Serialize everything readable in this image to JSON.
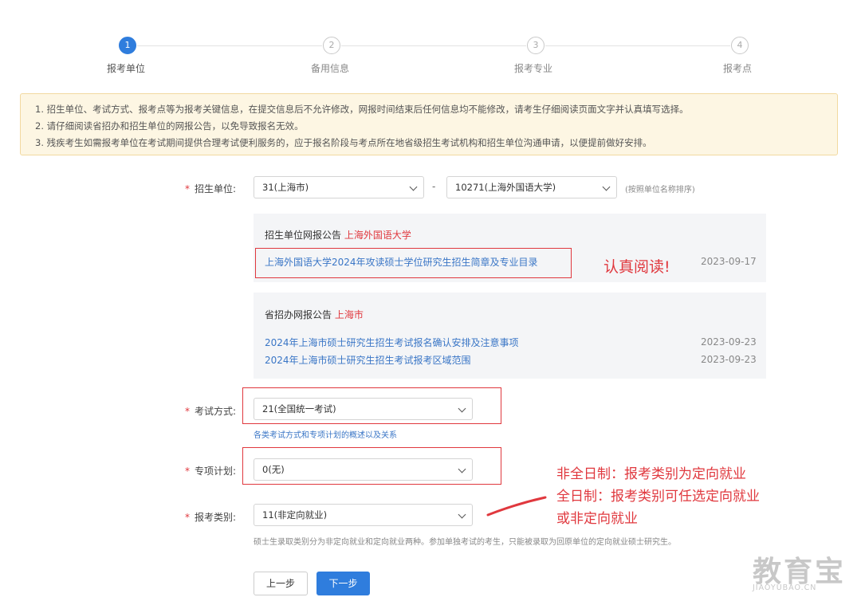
{
  "stepper": {
    "steps": [
      {
        "num": "1",
        "label": "报考单位"
      },
      {
        "num": "2",
        "label": "备用信息"
      },
      {
        "num": "3",
        "label": "报考专业"
      },
      {
        "num": "4",
        "label": "报考点"
      }
    ],
    "active_index": 0
  },
  "notice": {
    "lines": [
      "1. 招生单位、考试方式、报考点等为报考关键信息，在提交信息后不允许修改，网报时间结束后任何信息均不能修改，请考生仔细阅读页面文字并认真填写选择。",
      "2. 请仔细阅读省招办和招生单位的网报公告，以免导致报名无效。",
      "3. 残疾考生如需报考单位在考试期间提供合理考试便利服务的，应于报名阶段与考点所在地省级招生考试机构和招生单位沟通申请，以便提前做好安排。"
    ]
  },
  "form": {
    "unit": {
      "required": "*",
      "label": "招生单位:",
      "province_value": "31(上海市)",
      "separator": "-",
      "school_value": "10271(上海外国语大学)",
      "hint": "(按照单位名称排序)"
    },
    "exam_mode": {
      "required": "*",
      "label": "考试方式:",
      "value": "21(全国统一考试)",
      "hint_link": "各类考试方式和专项计划的概述以及关系"
    },
    "special_plan": {
      "required": "*",
      "label": "专项计划:",
      "value": "0(无)"
    },
    "category": {
      "required": "*",
      "label": "报考类别:",
      "value": "11(非定向就业)",
      "hint": "硕士生录取类别分为非定向就业和定向就业两种。参加单独考试的考生，只能被录取为回原单位的定向就业硕士研究生。"
    }
  },
  "unit_announcement": {
    "title": "招生单位网报公告",
    "title_highlight": "上海外国语大学",
    "items": [
      {
        "text": "上海外国语大学2024年攻读硕士学位研究生招生简章及专业目录",
        "date": "2023-09-17"
      }
    ]
  },
  "province_announcement": {
    "title": "省招办网报公告",
    "title_highlight": "上海市",
    "items": [
      {
        "text": "2024年上海市硕士研究生招生考试报名确认安排及注意事项",
        "date": "2023-09-23"
      },
      {
        "text": "2024年上海市硕士研究生招生考试报考区域范围",
        "date": "2023-09-23"
      }
    ]
  },
  "annotations": {
    "read_note": "认真阅读!",
    "category_note_lines": [
      "非全日制：报考类别为定向就业",
      "全日制：报考类别可任选定向就业",
      "或非定向就业"
    ]
  },
  "buttons": {
    "prev": "上一步",
    "next": "下一步"
  },
  "watermark": {
    "main": "教育宝",
    "sub": "JIAOYUBAO.CN"
  },
  "colors": {
    "primary": "#2f7ddd",
    "annotation_red": "#e0383e",
    "link_blue": "#3a76c6",
    "notice_bg": "#fdf6e3"
  }
}
